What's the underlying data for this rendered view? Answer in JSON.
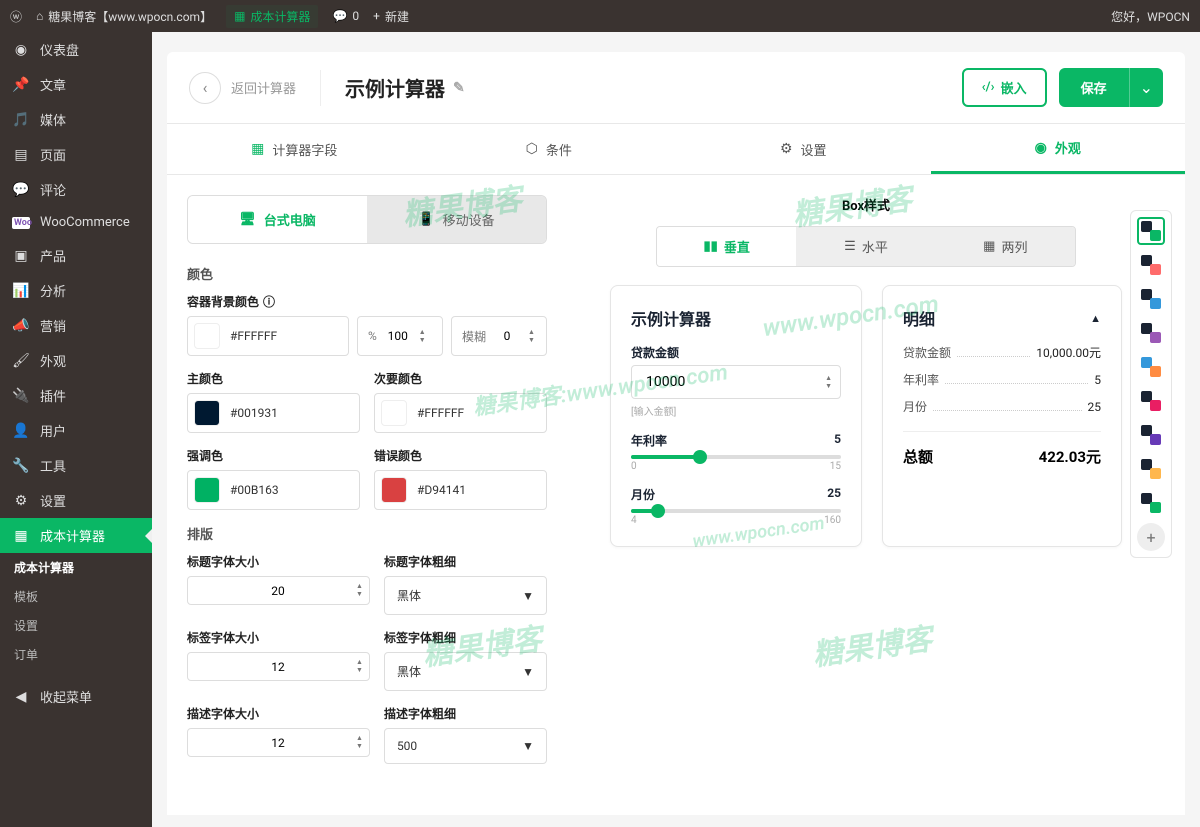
{
  "topbar": {
    "site": "糖果博客【www.wpocn.com】",
    "calculator": "成本计算器",
    "comments": "0",
    "new": "新建",
    "greeting": "您好，WPOCN"
  },
  "sidebar": {
    "items": [
      {
        "icon": "◉",
        "label": "仪表盘"
      },
      {
        "icon": "✎",
        "label": "文章"
      },
      {
        "icon": "❐",
        "label": "媒体"
      },
      {
        "icon": "▤",
        "label": "页面"
      },
      {
        "icon": "✉",
        "label": "评论"
      },
      {
        "icon": "W",
        "label": "WooCommerce"
      },
      {
        "icon": "▣",
        "label": "产品"
      },
      {
        "icon": "▮",
        "label": "分析"
      },
      {
        "icon": "◉",
        "label": "营销"
      },
      {
        "icon": "✦",
        "label": "外观"
      },
      {
        "icon": "⚙",
        "label": "插件"
      },
      {
        "icon": "▲",
        "label": "用户"
      },
      {
        "icon": "✔",
        "label": "工具"
      },
      {
        "icon": "⚙",
        "label": "设置"
      },
      {
        "icon": "▦",
        "label": "成本计算器",
        "active": true
      }
    ],
    "subs": [
      "成本计算器",
      "模板",
      "设置",
      "订单"
    ],
    "collapse": "收起菜单"
  },
  "header": {
    "back": "返回计算器",
    "title": "示例计算器",
    "embed": "嵌入",
    "save": "保存"
  },
  "tabs": [
    "计算器字段",
    "条件",
    "设置",
    "外观"
  ],
  "device": {
    "desktop": "台式电脑",
    "mobile": "移动设备"
  },
  "colors": {
    "section": "颜色",
    "container_bg": {
      "label": "容器背景颜色",
      "value": "#FFFFFF",
      "pct": "100",
      "blur_label": "模糊",
      "blur": "0"
    },
    "primary": {
      "label": "主颜色",
      "value": "#001931"
    },
    "secondary": {
      "label": "次要颜色",
      "value": "#FFFFFF"
    },
    "accent": {
      "label": "强调色",
      "value": "#00B163"
    },
    "error": {
      "label": "错误颜色",
      "value": "#D94141"
    }
  },
  "typography": {
    "section": "排版",
    "title_size": {
      "label": "标题字体大小",
      "value": "20"
    },
    "title_weight": {
      "label": "标题字体粗细",
      "value": "黑体"
    },
    "label_size": {
      "label": "标签字体大小",
      "value": "12"
    },
    "label_weight": {
      "label": "标签字体粗细",
      "value": "黑体"
    },
    "desc_size": {
      "label": "描述字体大小",
      "value": "12"
    },
    "desc_weight": {
      "label": "描述字体粗细",
      "value": "500"
    }
  },
  "box_style": {
    "title": "Box样式",
    "vertical": "垂直",
    "horizontal": "水平",
    "two_col": "两列"
  },
  "preview": {
    "calc_title": "示例计算器",
    "loan_label": "贷款金额",
    "loan_value": "10000",
    "loan_hint": "[输入金额]",
    "rate_label": "年利率",
    "rate_value": "5",
    "rate_min": "0",
    "rate_max": "15",
    "months_label": "月份",
    "months_value": "25",
    "months_min": "4",
    "months_max": "160"
  },
  "details": {
    "title": "明细",
    "loan": {
      "label": "贷款金额",
      "value": "10,000.00元"
    },
    "rate": {
      "label": "年利率",
      "value": "5"
    },
    "months": {
      "label": "月份",
      "value": "25"
    },
    "total": {
      "label": "总额",
      "value": "422.03元"
    }
  },
  "themes": [
    {
      "c1": "#1a2332",
      "c2": "#0ab765",
      "selected": true
    },
    {
      "c1": "#1a2332",
      "c2": "#ff6b6b"
    },
    {
      "c1": "#1a2332",
      "c2": "#3498db"
    },
    {
      "c1": "#1a2332",
      "c2": "#9b59b6"
    },
    {
      "c1": "#3498db",
      "c2": "#ff8c42"
    },
    {
      "c1": "#1a2332",
      "c2": "#e91e63"
    },
    {
      "c1": "#1a2332",
      "c2": "#673ab7"
    },
    {
      "c1": "#1a2332",
      "c2": "#ffb74d"
    },
    {
      "c1": "#1a2332",
      "c2": "#0ab765"
    }
  ],
  "watermarks": [
    "糖果博客",
    "糖果博客",
    "糖果博客:www.wpocn.com",
    "www.wpocn.com",
    "糖果博客",
    "糖果博客",
    "www.wpocn.com"
  ]
}
